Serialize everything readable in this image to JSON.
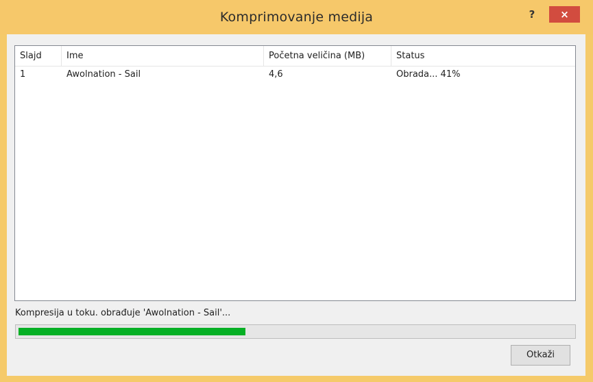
{
  "window": {
    "title": "Komprimovanje medija",
    "help_label": "?",
    "close_label": "×"
  },
  "list": {
    "columns": [
      "Slajd",
      "Ime",
      "Početna veličina (MB)",
      "Status"
    ],
    "rows": [
      [
        "1",
        "Awolnation - Sail",
        "4,6",
        "Obrada... 41%"
      ]
    ]
  },
  "status_text": "Kompresija u toku. obrađuje 'Awolnation - Sail'...",
  "progress": {
    "percent": 41,
    "color": "#06b025"
  },
  "buttons": {
    "cancel_label": "Otkaži"
  }
}
